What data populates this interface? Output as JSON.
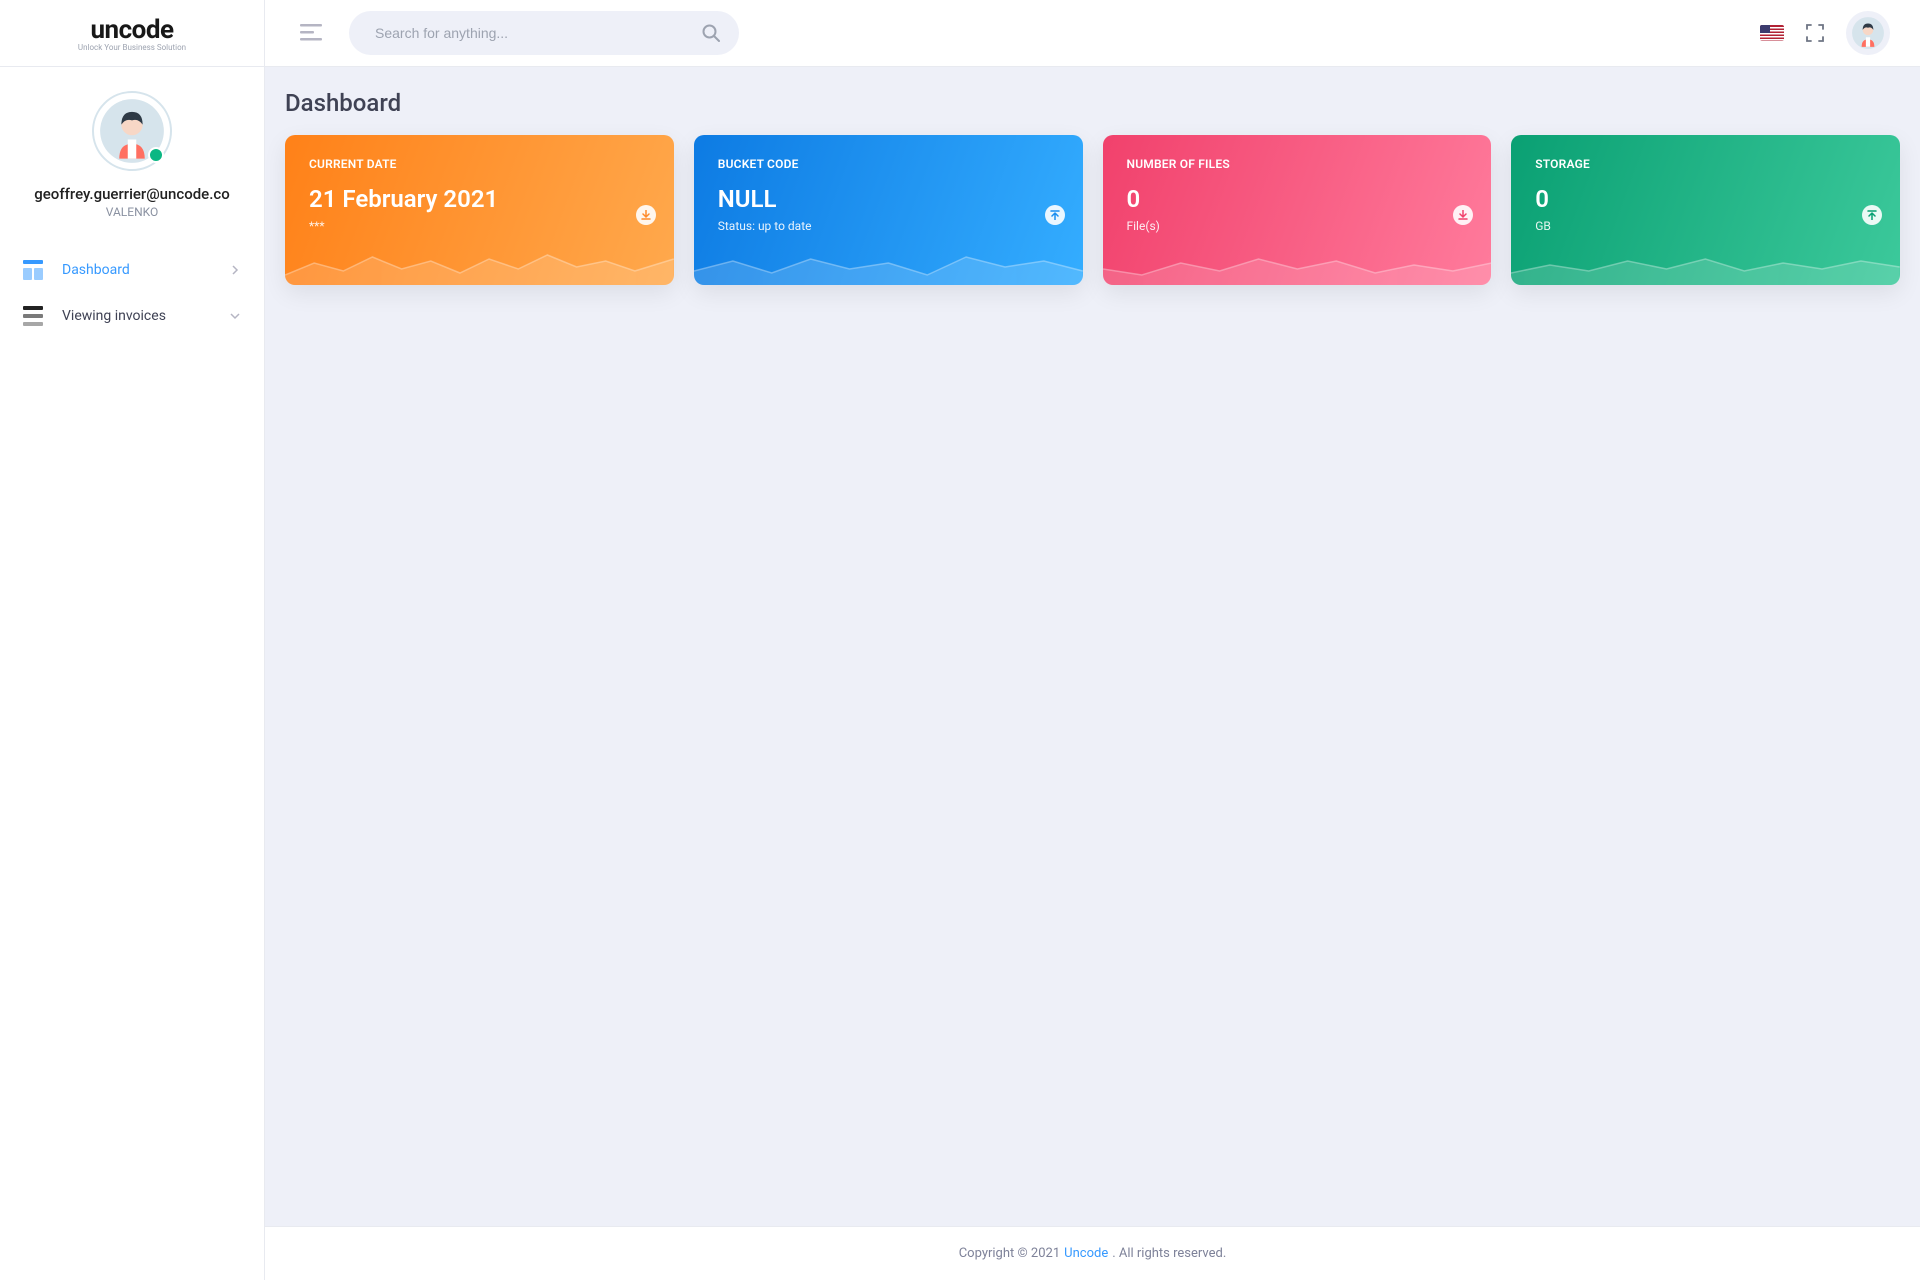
{
  "logo": {
    "title": "uncode",
    "subtitle": "Unlock Your Business Solution"
  },
  "user": {
    "email": "geoffrey.guerrier@uncode.co",
    "company": "VALENKO"
  },
  "sidebar": {
    "items": [
      {
        "label": "Dashboard",
        "active": true
      },
      {
        "label": "Viewing invoices",
        "active": false
      }
    ]
  },
  "search": {
    "placeholder": "Search for anything..."
  },
  "page": {
    "title": "Dashboard"
  },
  "cards": [
    {
      "label": "CURRENT DATE",
      "value": "21 February 2021",
      "sub": "***",
      "action": "download"
    },
    {
      "label": "BUCKET CODE",
      "value": "NULL",
      "sub": "Status: up to date",
      "action": "upload"
    },
    {
      "label": "NUMBER OF FILES",
      "value": "0",
      "sub": "File(s)",
      "action": "download"
    },
    {
      "label": "STORAGE",
      "value": "0",
      "sub": "GB",
      "action": "upload"
    }
  ],
  "footer": {
    "prefix": "Copyright © 2021",
    "brand": "Uncode",
    "suffix": ". All rights reserved."
  }
}
